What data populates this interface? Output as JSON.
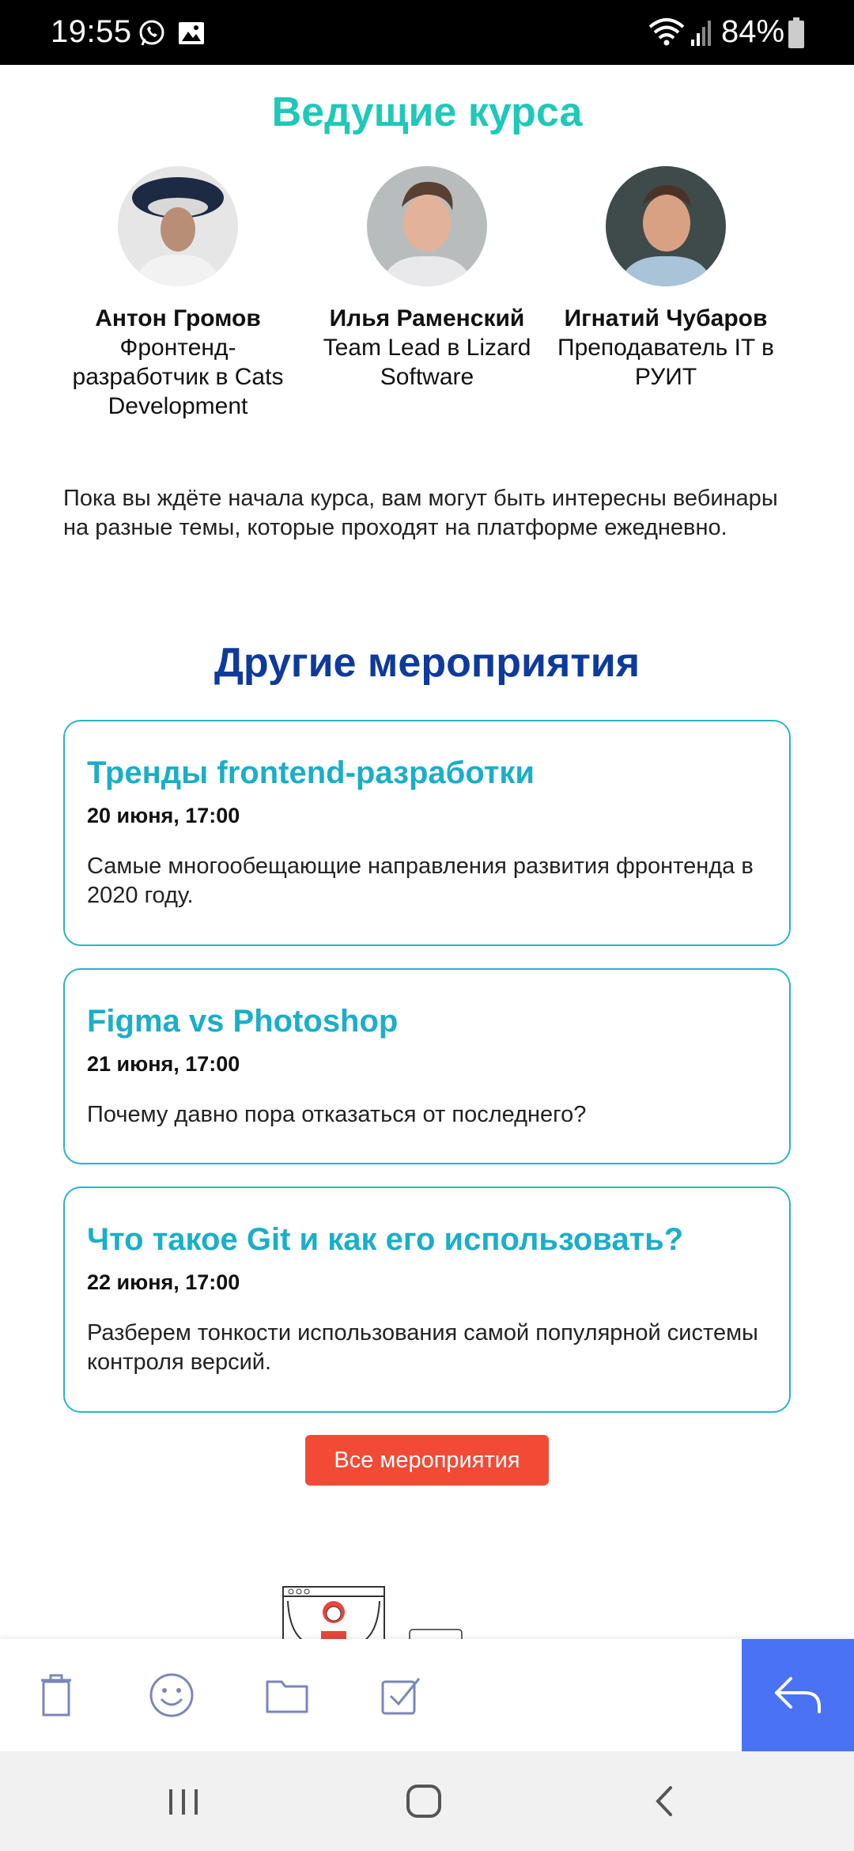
{
  "status_bar": {
    "time": "19:55",
    "battery": "84%",
    "icons": [
      "whatsapp-icon",
      "image-icon",
      "wifi-icon",
      "signal-icon",
      "battery-icon"
    ]
  },
  "speakers": {
    "title": "Ведущие курса",
    "items": [
      {
        "name": "Антон Громов",
        "role": "Фронтенд-разработчик в Cats Development"
      },
      {
        "name": "Илья Раменский",
        "role": "Team Lead в Lizard Software"
      },
      {
        "name": "Игнатий Чубаров",
        "role": "Преподаватель IT в РУИТ"
      }
    ]
  },
  "intro": "Пока вы ждёте начала курса, вам могут быть интересны вебинары на разные темы, которые проходят на платформе ежедневно.",
  "events": {
    "title": "Другие мероприятия",
    "items": [
      {
        "title": "Тренды frontend-разработки",
        "date": "20 июня, 17:00",
        "description": "Самые многообещающие направления развития фронтенда в 2020 году."
      },
      {
        "title": "Figma vs Photoshop",
        "date": "21 июня, 17:00",
        "description": "Почему давно пора отказаться от последнего?"
      },
      {
        "title": "Что такое Git и как его использовать?",
        "date": "22 июня, 17:00",
        "description": "Разберем тонкости использования самой популярной системы контроля версий."
      }
    ],
    "all_button": "Все мероприятия"
  },
  "toolbar": {
    "icons": [
      "trash-icon",
      "emoji-icon",
      "folder-icon",
      "task-icon",
      "reply-icon"
    ]
  },
  "colors": {
    "speakers_title": "#1fc8b8",
    "events_title": "#0e3a9c",
    "event_title": "#1aaec9",
    "card_border": "#28b5c4",
    "button": "#f14a35",
    "reply": "#4a72f5"
  }
}
